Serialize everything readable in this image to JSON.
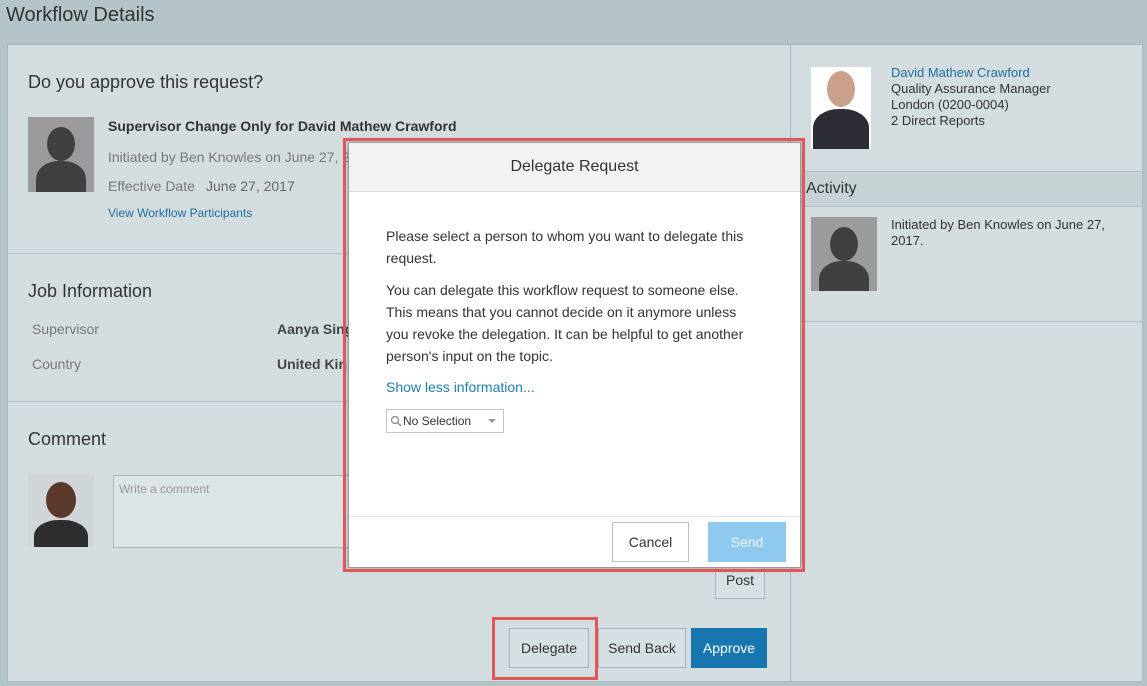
{
  "page": {
    "title": "Workflow Details"
  },
  "request": {
    "question": "Do you approve this request?",
    "title": "Supervisor Change Only for David Mathew Crawford",
    "initiated": "Initiated by Ben Knowles on June 27, 2",
    "effective_label": "Effective Date",
    "effective_date": "June 27, 2017",
    "participants_link": "View Workflow Participants"
  },
  "job_info": {
    "heading": "Job Information",
    "rows": [
      {
        "label": "Supervisor",
        "value": "Aanya Sing"
      },
      {
        "label": "Country",
        "value": "United Kin"
      }
    ]
  },
  "comment": {
    "heading": "Comment",
    "placeholder": "Write a comment",
    "post_label": "Post"
  },
  "actions": {
    "delegate": "Delegate",
    "send_back": "Send Back",
    "approve": "Approve"
  },
  "person": {
    "name": "David Mathew Crawford",
    "role": "Quality Assurance Manager",
    "location": "London (0200-0004)",
    "reports": "2 Direct Reports"
  },
  "activity": {
    "heading": "Activity",
    "line1": "Initiated by Ben Knowles on June 27,",
    "line2": "2017."
  },
  "modal": {
    "title": "Delegate Request",
    "p1_line1": "Please select a person to whom you want to delegate this",
    "p1_line2": "request.",
    "p2_line1": "You can delegate this workflow request to someone else.",
    "p2_line2": "This means that you cannot decide on it anymore unless",
    "p2_line3": "you revoke the delegation. It can be helpful to get another",
    "p2_line4": "person's input on the topic.",
    "show_less": "Show less information...",
    "select_value": "No Selection",
    "cancel": "Cancel",
    "send": "Send"
  },
  "colors": {
    "accent": "#1776b0",
    "highlight": "#e05757",
    "send_disabled": "#8ec9f0"
  }
}
